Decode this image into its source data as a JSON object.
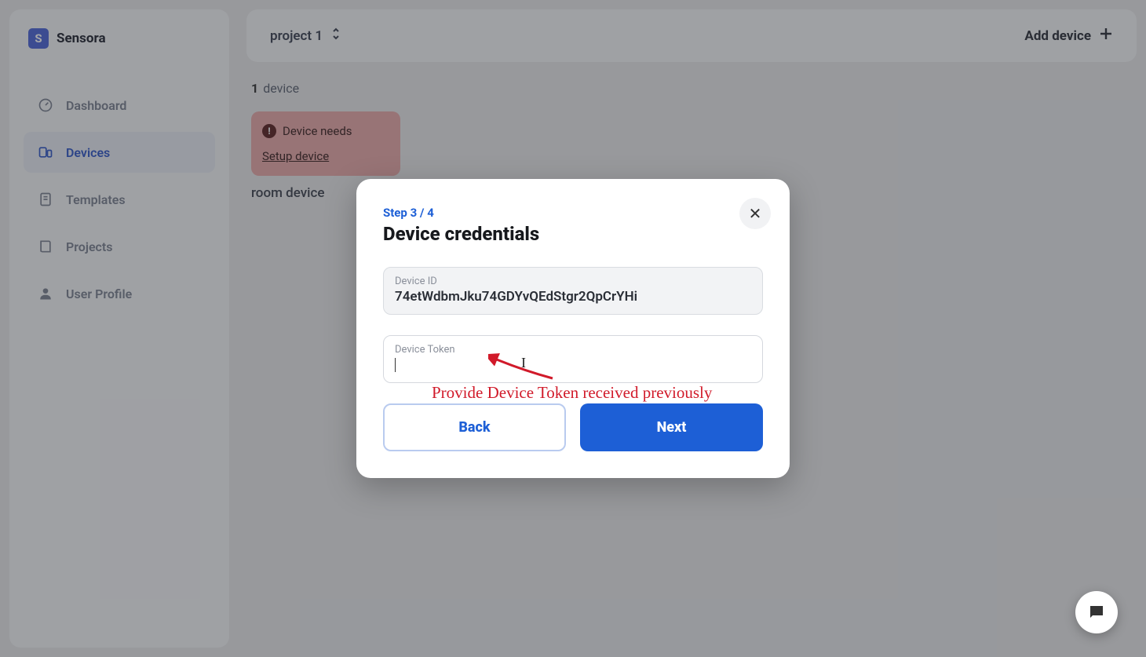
{
  "brand": {
    "name": "Sensora",
    "logo_letter": "S"
  },
  "sidebar": {
    "items": [
      {
        "label": "Dashboard",
        "icon": "gauge-icon"
      },
      {
        "label": "Devices",
        "icon": "devices-icon"
      },
      {
        "label": "Templates",
        "icon": "template-icon"
      },
      {
        "label": "Projects",
        "icon": "book-icon"
      },
      {
        "label": "User Profile",
        "icon": "user-icon"
      }
    ],
    "active_index": 1
  },
  "topbar": {
    "project_label": "project 1",
    "add_device_label": "Add device"
  },
  "content": {
    "device_count_value": "1",
    "device_count_word": "device",
    "warning_text": "Device needs",
    "setup_link": "Setup device",
    "device_name": "room device"
  },
  "modal": {
    "step_label": "Step 3 / 4",
    "title": "Device credentials",
    "device_id_label": "Device ID",
    "device_id_value": "74etWdbmJku74GDYvQEdStgr2QpCrYHi",
    "token_label": "Device Token",
    "token_value": "",
    "back_label": "Back",
    "next_label": "Next"
  },
  "annotation": {
    "text": "Provide Device Token received previously",
    "color": "#d11a2a"
  }
}
